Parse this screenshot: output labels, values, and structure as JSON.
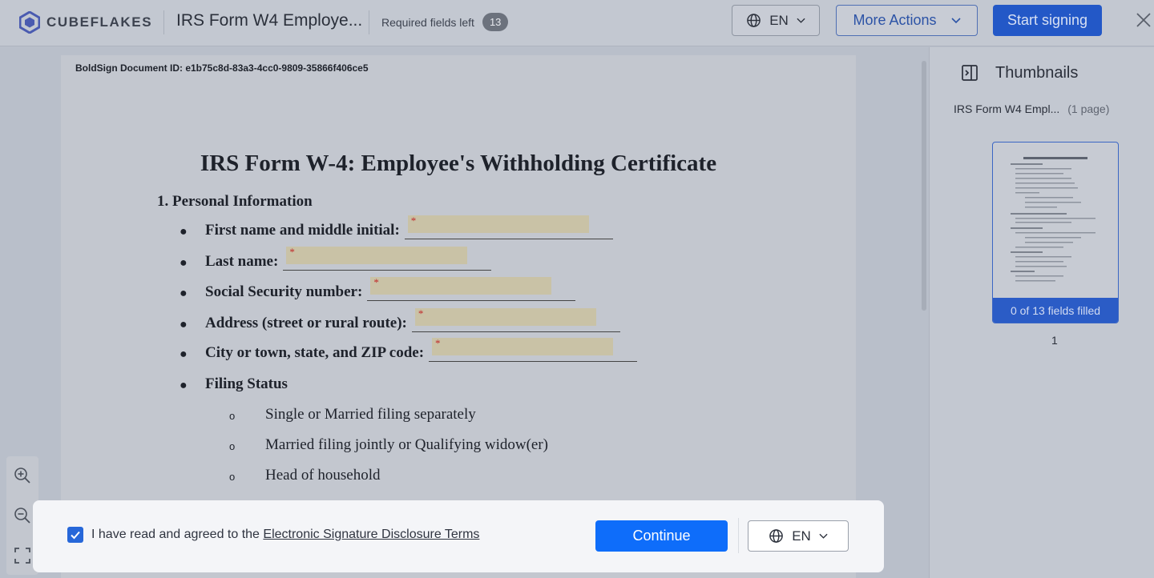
{
  "header": {
    "brand": "CUBEFLAKES",
    "doc_title": "IRS Form W4 Employe...",
    "required_label": "Required fields left",
    "required_count": "13",
    "language": "EN",
    "more_actions": "More Actions",
    "start_signing": "Start signing"
  },
  "document": {
    "doc_id": "BoldSign Document ID: e1b75c8d-83a3-4cc0-9809-35866f406ce5",
    "title": "IRS Form W-4: Employee's Withholding Certificate",
    "section": "1. Personal Information",
    "fields": [
      {
        "label": "First name and middle initial",
        "required_mark": "*"
      },
      {
        "label": "Last name",
        "required_mark": "*"
      },
      {
        "label": "Social Security number",
        "required_mark": "*"
      },
      {
        "label": "Address (street or rural route)",
        "required_mark": "*"
      },
      {
        "label": "City or town, state, and ZIP code",
        "required_mark": "*"
      }
    ],
    "filing_status_label": "Filing Status",
    "filing_options": [
      "Single or Married filing separately",
      "Married filing jointly or Qualifying widow(er)",
      "Head of household"
    ]
  },
  "sidebar": {
    "title": "Thumbnails",
    "file_name": "IRS Form W4 Empl...",
    "page_count": "(1 page)",
    "fields_filled": "0 of 13 fields filled",
    "page_number": "1"
  },
  "consent": {
    "text": "I have read and agreed to the ",
    "link": "Electronic Signature Disclosure Terms",
    "checked": true,
    "continue": "Continue",
    "language": "EN"
  },
  "colors": {
    "primary": "#0e6dfa",
    "header_primary_dimmed": "#2358c7",
    "required_star": "#c12a2a"
  }
}
